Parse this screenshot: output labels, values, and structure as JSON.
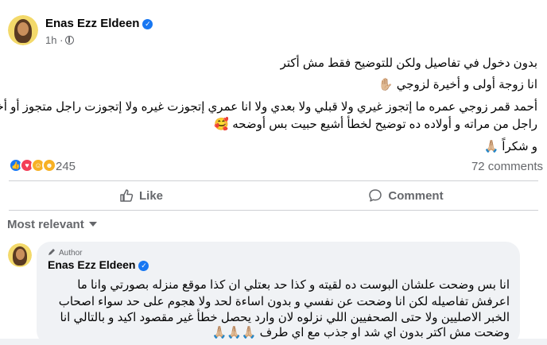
{
  "post": {
    "author": "Enas Ezz Eldeen",
    "time": "1h",
    "lines": [
      "بدون دخول في تفاصيل ولكن للتوضيح فقط مش أكتر",
      "انا زوجة أولى و أخيرة لزوجي ✋🏼",
      "أحمد قمر زوجي عمره ما إتجوز غيري ولا قبلي ولا بعدي ولا انا عمري إتجوزت غيره ولا إتجوزت راجل متجوز أو أخدت",
      "راجل من مراته و أولاده ده توضيح لخطأ أشيع حبيت بس أوضحه 🥰",
      "و شكراً 🙏🏼"
    ]
  },
  "stats": {
    "reaction_count": "245",
    "comments_label": "72 comments",
    "reactions": [
      "like-icon",
      "love-icon",
      "care-icon",
      "haha-icon"
    ]
  },
  "actions": {
    "like": "Like",
    "comment": "Comment"
  },
  "sort": {
    "label": "Most relevant"
  },
  "comment": {
    "badge": "Author",
    "author": "Enas Ezz Eldeen",
    "lines": [
      "انا بس وضحت علشان البوست ده لقيته و كذا حد بعتلي ان كذا موقع منزله بصورتي وانا ما",
      "اعرفش تفاصيله لكن انا وضحت عن نفسي و بدون اساءة لحد ولا هجوم على حد سواء اصحاب",
      "الخبر الاصليين ولا حتى الصحفيين اللي نزلوه لان وارد يحصل خطأ غير مقصود اكيد و بالتالي انا",
      "وضحت مش اكتر بدون اي شد او جذب مع اي طرف 🙏🏼🙏🏼🙏🏼"
    ]
  },
  "colors": {
    "brand": "#1877f2",
    "secondary_text": "#65676b",
    "love": "#f33e58",
    "care": "#f7b125"
  }
}
